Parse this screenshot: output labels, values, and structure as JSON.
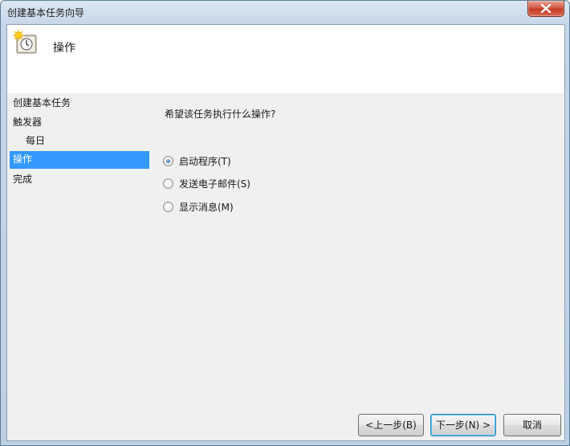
{
  "window": {
    "title": "创建基本任务向导"
  },
  "header": {
    "title": "操作",
    "icon": "clock-task-icon"
  },
  "nav": {
    "items": [
      {
        "label": "创建基本任务"
      },
      {
        "label": "触发器"
      },
      {
        "label": "每日"
      },
      {
        "label": "操作",
        "selected": true
      },
      {
        "label": "完成"
      }
    ]
  },
  "main": {
    "question": "希望该任务执行什么操作?",
    "options": [
      {
        "label": "启动程序(T)",
        "checked": true
      },
      {
        "label": "发送电子邮件(S)",
        "checked": false
      },
      {
        "label": "显示消息(M)",
        "checked": false
      }
    ]
  },
  "buttons": {
    "back": "<上一步(B)",
    "next": "下一步(N) >",
    "cancel": "取消"
  },
  "colors": {
    "selection": "#3399ff",
    "client_bg": "#f0f0f0",
    "close_red": "#c33a23"
  }
}
